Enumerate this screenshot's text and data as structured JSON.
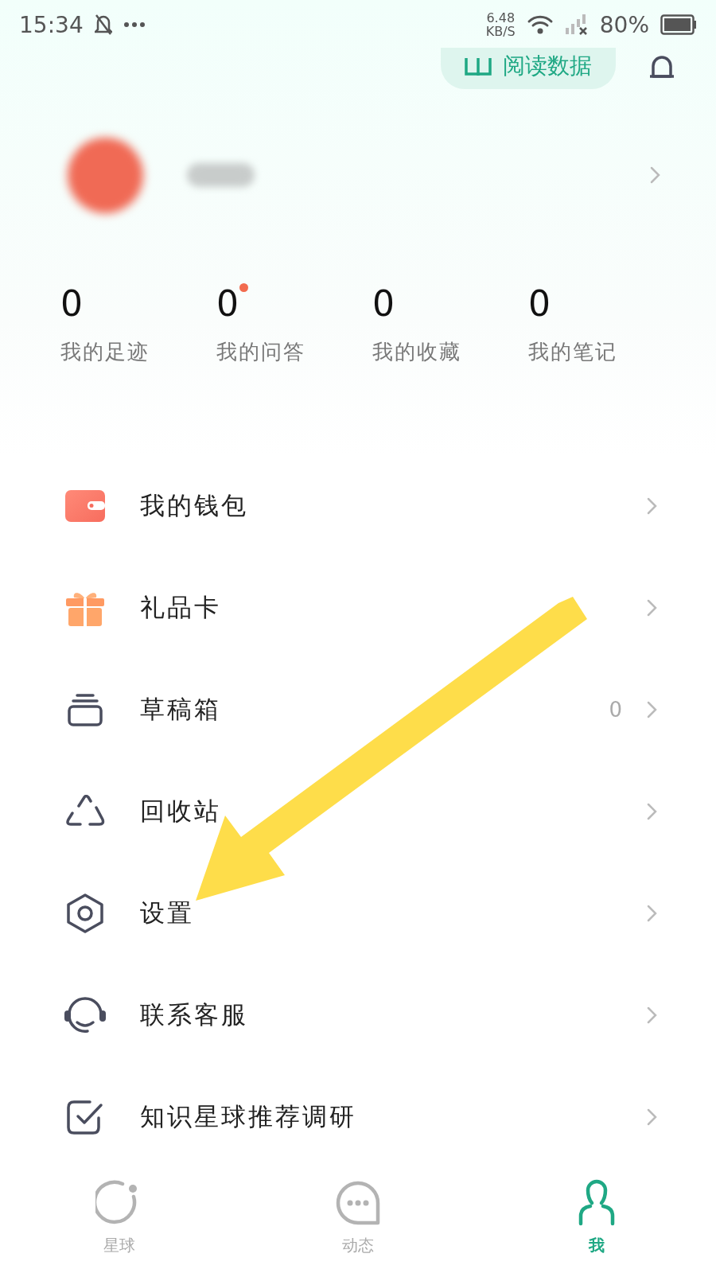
{
  "status_bar": {
    "time": "15:34",
    "speed_value": "6.48",
    "speed_unit": "KB/S",
    "battery": "80%"
  },
  "header": {
    "reading_data_button": "阅读数据"
  },
  "stats": [
    {
      "count": "0",
      "label": "我的足迹",
      "unread": false
    },
    {
      "count": "0",
      "label": "我的问答",
      "unread": true
    },
    {
      "count": "0",
      "label": "我的收藏",
      "unread": false
    },
    {
      "count": "0",
      "label": "我的笔记",
      "unread": false
    }
  ],
  "menu": [
    {
      "label": "我的钱包"
    },
    {
      "label": "礼品卡"
    },
    {
      "label": "草稿箱",
      "count": "0"
    },
    {
      "label": "回收站"
    },
    {
      "label": "设置"
    },
    {
      "label": "联系客服"
    },
    {
      "label": "知识星球推荐调研"
    }
  ],
  "bottom_nav": [
    {
      "label": "星球",
      "selected": false
    },
    {
      "label": "动态",
      "selected": false
    },
    {
      "label": "我",
      "selected": true
    }
  ]
}
